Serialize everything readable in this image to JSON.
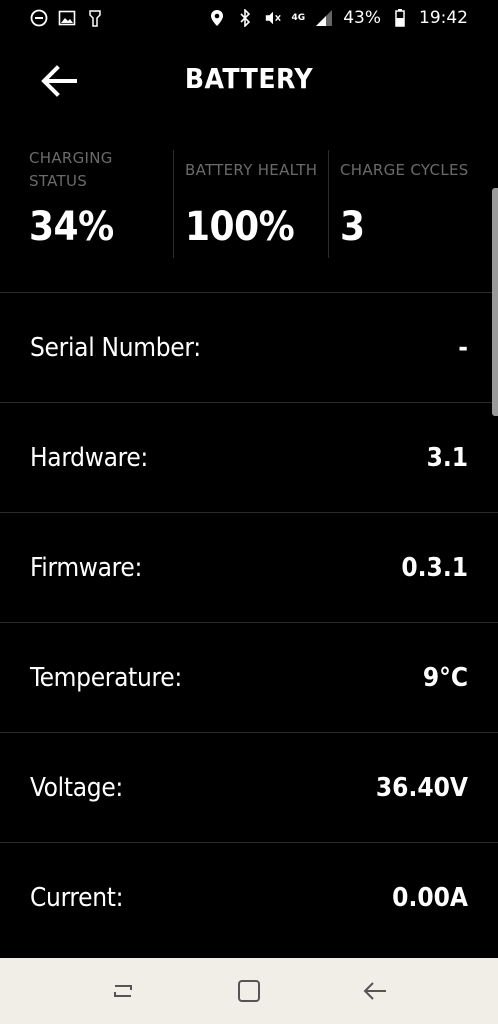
{
  "status_bar": {
    "battery_percent": "43%",
    "time": "19:42",
    "network": "4G",
    "icons": [
      "minus-circle-icon",
      "gallery-icon",
      "flashlight-icon",
      "location-icon",
      "bluetooth-icon",
      "mute-icon",
      "signal-icon",
      "battery-icon"
    ]
  },
  "header": {
    "title": "BATTERY"
  },
  "stats": [
    {
      "label": "CHARGING STATUS",
      "value": "34%"
    },
    {
      "label": "BATTERY HEALTH",
      "value": "100%"
    },
    {
      "label": "CHARGE CYCLES",
      "value": "3"
    }
  ],
  "rows": [
    {
      "label": "Serial Number:",
      "value": "-"
    },
    {
      "label": "Hardware:",
      "value": "3.1"
    },
    {
      "label": "Firmware:",
      "value": "0.3.1"
    },
    {
      "label": "Temperature:",
      "value": "9°C"
    },
    {
      "label": "Voltage:",
      "value": "36.40V"
    },
    {
      "label": "Current:",
      "value": "0.00A"
    }
  ],
  "nav_bar": {
    "icons": [
      "recents-icon",
      "home-icon",
      "back-icon"
    ]
  }
}
